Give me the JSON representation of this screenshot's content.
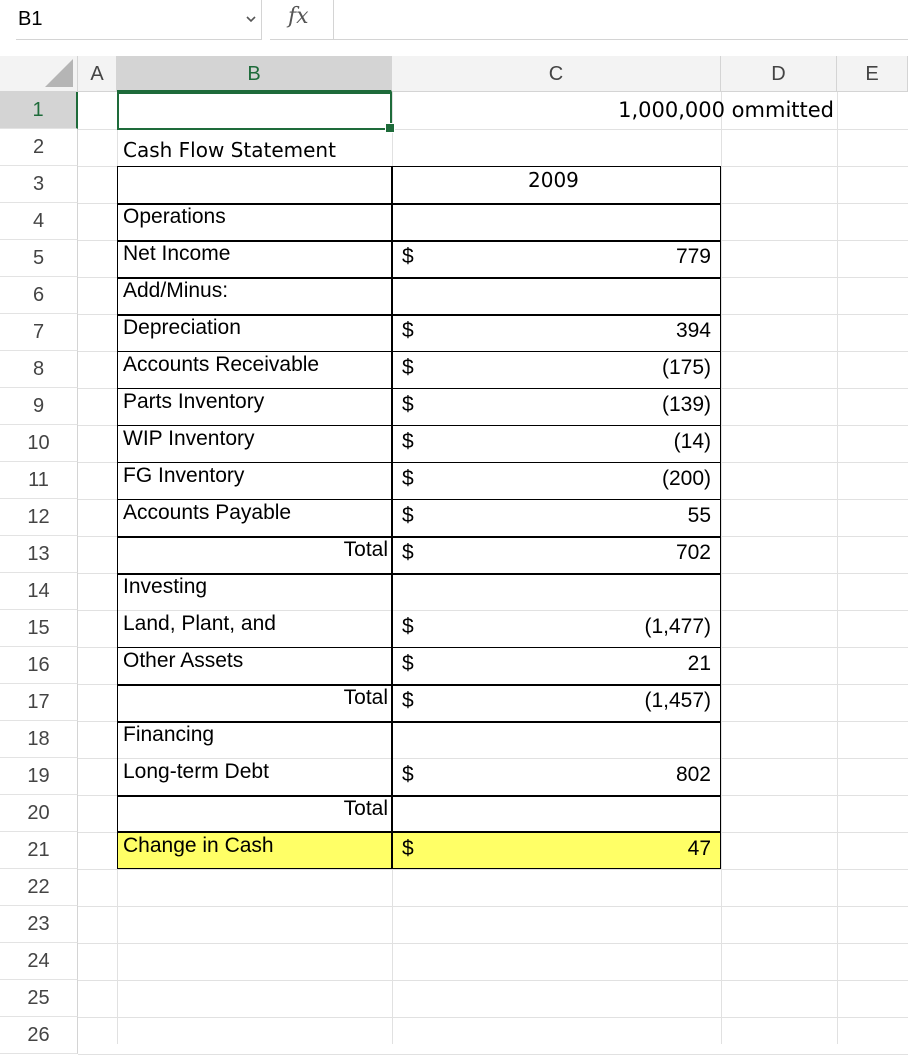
{
  "formula_bar": {
    "name_box": "B1",
    "fx": "fx",
    "formula": ""
  },
  "columns": [
    "A",
    "B",
    "C",
    "D",
    "E"
  ],
  "selected_column": "B",
  "rows": [
    "1",
    "2",
    "3",
    "4",
    "5",
    "6",
    "7",
    "8",
    "9",
    "10",
    "11",
    "12",
    "13",
    "14",
    "15",
    "16",
    "17",
    "18",
    "19",
    "20",
    "21",
    "22",
    "23",
    "24",
    "25",
    "26"
  ],
  "selected_row": "1",
  "sheet": {
    "note": "1,000,000 ommitted",
    "title": "Cash Flow Statement",
    "year": "2009",
    "operations_label": "Operations",
    "net_income": {
      "label": "Net Income",
      "sym": "$",
      "value": "779"
    },
    "add_minus": "Add/Minus:",
    "depreciation": {
      "label": "Depreciation",
      "sym": "$",
      "value": "394"
    },
    "accounts_receivable": {
      "label": "Accounts Receivable",
      "sym": "$",
      "value": "(175)"
    },
    "parts_inventory": {
      "label": "Parts Inventory",
      "sym": "$",
      "value": "(139)"
    },
    "wip_inventory": {
      "label": "WIP Inventory",
      "sym": "$",
      "value": "(14)"
    },
    "fg_inventory": {
      "label": "FG Inventory",
      "sym": "$",
      "value": "(200)"
    },
    "accounts_payable": {
      "label": "Accounts Payable",
      "sym": "$",
      "value": "55"
    },
    "operations_total": {
      "label": "Total",
      "sym": "$",
      "value": "702"
    },
    "investing_label": "Investing",
    "land_plant": {
      "label": "Land, Plant, and",
      "sym": "$",
      "value": "(1,477)"
    },
    "other_assets": {
      "label": "Other Assets",
      "sym": "$",
      "value": "21"
    },
    "investing_total": {
      "label": "Total",
      "sym": "$",
      "value": "(1,457)"
    },
    "financing_label": "Financing",
    "long_term_debt": {
      "label": "Long-term Debt",
      "sym": "$",
      "value": "802"
    },
    "financing_total": {
      "label": "Total"
    },
    "change_in_cash": {
      "label": "Change in Cash",
      "sym": "$",
      "value": "47"
    }
  },
  "colors": {
    "accent": "#1e6b3a",
    "highlight": "#ffff66"
  }
}
